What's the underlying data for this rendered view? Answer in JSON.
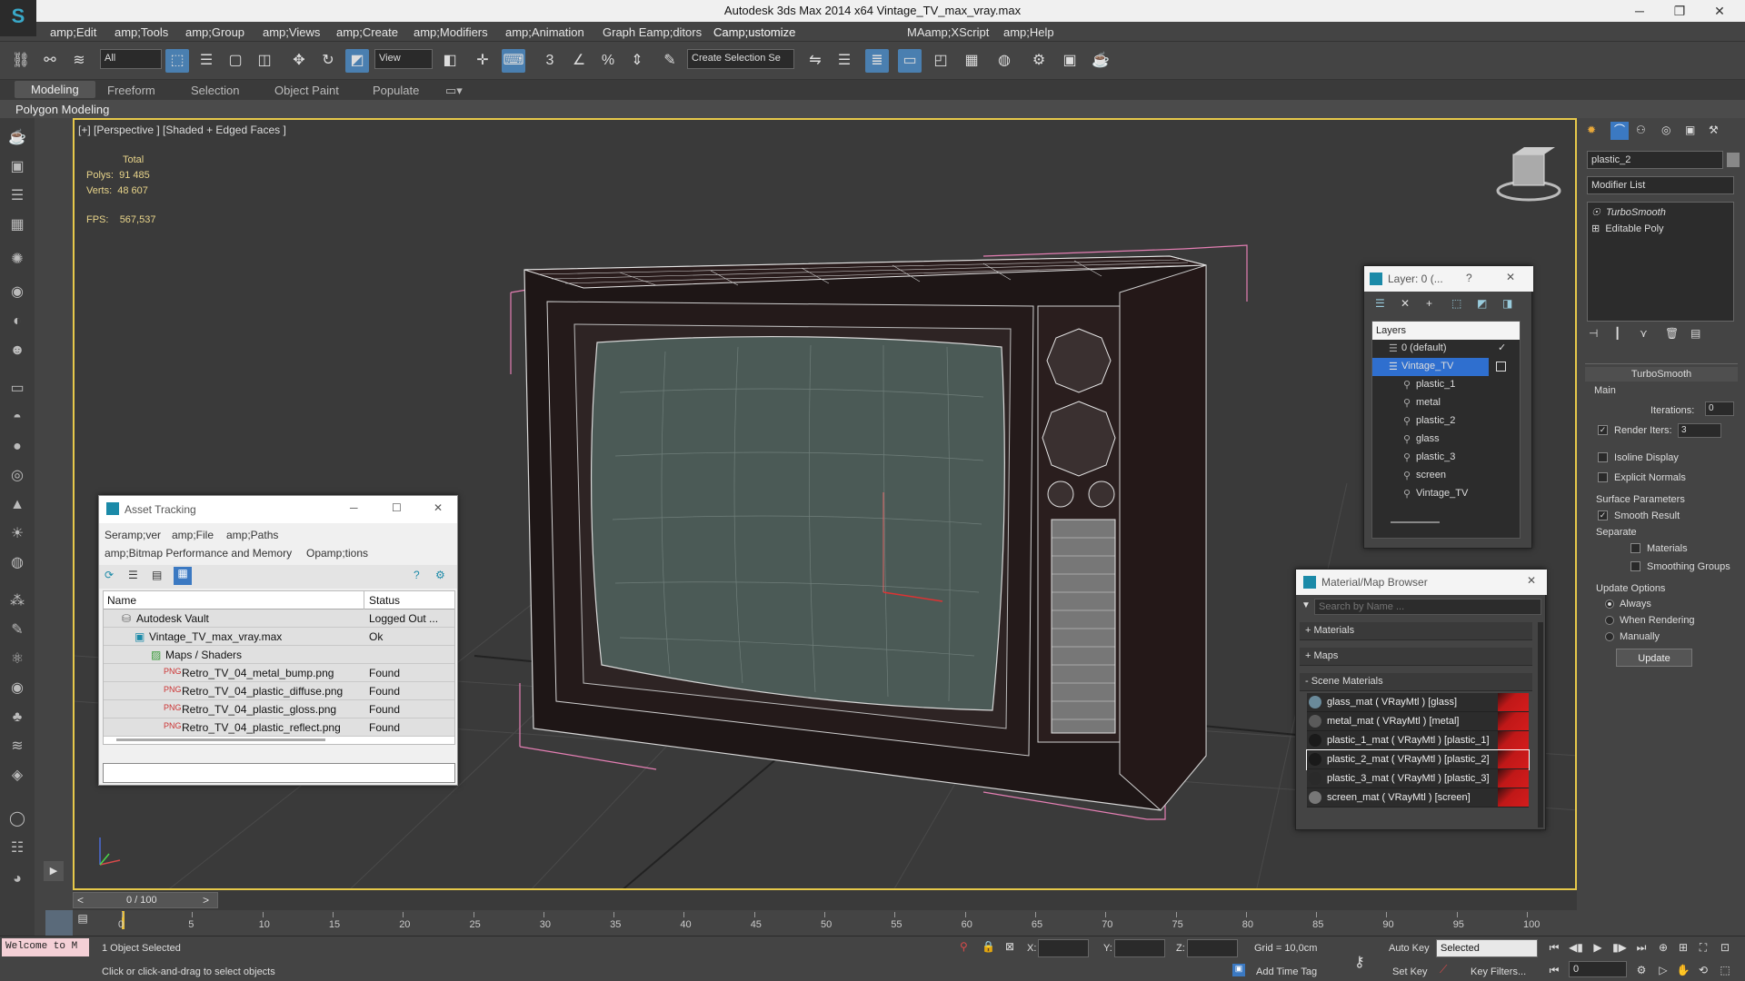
{
  "window": {
    "title": "Autodesk 3ds Max  2014 x64     Vintage_TV_max_vray.max",
    "minimize": "─",
    "restore": "❐",
    "close": "✕"
  },
  "menu": [
    "amp;Edit",
    "amp;Tools",
    "amp;Group",
    "amp;Views",
    "amp;Create",
    "amp;Modifiers",
    "amp;Animation",
    "Graph Eamp;ditors",
    "Camp;ustomize",
    "MAamp;XScript",
    "amp;Help"
  ],
  "toolbar": {
    "selection_filter": "All",
    "ref_coord": "View",
    "named_selection": "Create Selection Se"
  },
  "ribbon": {
    "tabs": [
      "Modeling",
      "Freeform",
      "Selection",
      "Object Paint",
      "Populate"
    ],
    "subpanel": "Polygon Modeling"
  },
  "viewport": {
    "label": "[+] [Perspective ] [Shaded + Edged Faces ]",
    "stats_header": "Total",
    "polys_label": "Polys:",
    "polys_value": "91 485",
    "verts_label": "Verts:",
    "verts_value": "48 607",
    "fps_label": "FPS:",
    "fps_value": "567,537"
  },
  "asset_tracking": {
    "title": "Asset Tracking",
    "menu": [
      "Seramp;ver",
      "amp;File",
      "amp;Paths",
      "amp;Bitmap Performance and Memory",
      "Opamp;tions"
    ],
    "columns": [
      "Name",
      "Status"
    ],
    "rows": [
      {
        "name": "Autodesk Vault",
        "status": "Logged Out ..."
      },
      {
        "name": "Vintage_TV_max_vray.max",
        "status": "Ok"
      },
      {
        "name": "Maps / Shaders",
        "status": ""
      },
      {
        "name": "Retro_TV_04_metal_bump.png",
        "status": "Found"
      },
      {
        "name": "Retro_TV_04_plastic_diffuse.png",
        "status": "Found"
      },
      {
        "name": "Retro_TV_04_plastic_gloss.png",
        "status": "Found"
      },
      {
        "name": "Retro_TV_04_plastic_reflect.png",
        "status": "Found"
      }
    ]
  },
  "layers": {
    "title": "Layer: 0 (...",
    "help": "?",
    "header": "Layers",
    "items": [
      "0 (default)",
      "Vintage_TV",
      "plastic_1",
      "metal",
      "plastic_2",
      "glass",
      "plastic_3",
      "screen",
      "Vintage_TV"
    ]
  },
  "material_browser": {
    "title": "Material/Map Browser",
    "search_placeholder": "Search by Name ...",
    "sections": [
      "+ Materials",
      "+ Maps",
      "- Scene Materials"
    ],
    "materials": [
      "glass_mat  ( VRayMtl ) [glass]",
      "metal_mat  ( VRayMtl ) [metal]",
      "plastic_1_mat  ( VRayMtl ) [plastic_1]",
      "plastic_2_mat  ( VRayMtl ) [plastic_2]",
      "plastic_3_mat  ( VRayMtl ) [plastic_3]",
      "screen_mat  ( VRayMtl ) [screen]"
    ]
  },
  "command_panel": {
    "object_name": "plastic_2",
    "modifier_list": "Modifier List",
    "stack": [
      "TurboSmooth",
      "Editable Poly"
    ],
    "rollout_title": "TurboSmooth",
    "main_label": "Main",
    "iterations_label": "Iterations:",
    "iterations_value": "0",
    "render_iters_label": "Render Iters:",
    "render_iters_value": "3",
    "isoline": "Isoline Display",
    "explicit_normals": "Explicit Normals",
    "surface_params": "Surface Parameters",
    "smooth_result": "Smooth Result",
    "separate": "Separate",
    "materials": "Materials",
    "smoothing_groups": "Smoothing Groups",
    "update_options": "Update Options",
    "always": "Always",
    "when_rendering": "When Rendering",
    "manually": "Manually",
    "update_button": "Update"
  },
  "timeline": {
    "frame": "0 / 100",
    "ticks": [
      "0",
      "5",
      "10",
      "15",
      "20",
      "25",
      "30",
      "35",
      "40",
      "45",
      "50",
      "55",
      "60",
      "65",
      "70",
      "75",
      "80",
      "85",
      "90",
      "95",
      "100"
    ]
  },
  "status": {
    "welcome": "Welcome to M",
    "selected_text": "1 Object Selected",
    "prompt": "Click or click-and-drag to select objects",
    "x_label": "X:",
    "y_label": "Y:",
    "z_label": "Z:",
    "grid": "Grid = 10,0cm",
    "add_time_tag": "Add Time Tag",
    "auto_key": "Auto Key",
    "set_key": "Set Key",
    "key_mode": "Selected",
    "key_filters": "Key Filters...",
    "current_frame": "0"
  },
  "colors": {
    "accent": "#4a7fb0",
    "viewport_border": "#e6c84a",
    "stats_text": "#e8d48a",
    "selection_red": "#c01818"
  }
}
